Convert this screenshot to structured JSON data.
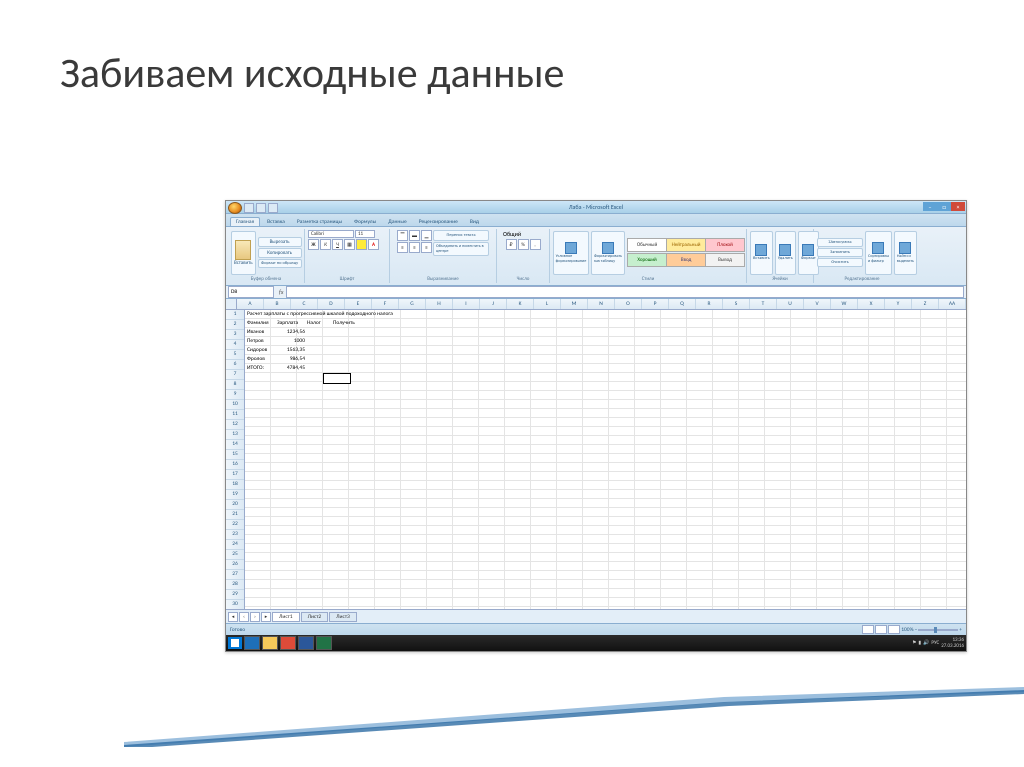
{
  "slide": {
    "title": "Забиваем исходные данные"
  },
  "window": {
    "title": "Лаба - Microsoft Excel",
    "min": "–",
    "max": "□",
    "close": "×"
  },
  "tabs": {
    "items": [
      "Главная",
      "Вставка",
      "Разметка страницы",
      "Формулы",
      "Данные",
      "Рецензирование",
      "Вид"
    ],
    "active": 0
  },
  "ribbon": {
    "clipboard": {
      "paste": "Вставить",
      "cut": "Вырезать",
      "copy": "Копировать",
      "format": "Формат по образцу",
      "label": "Буфер обмена"
    },
    "font": {
      "name": "Calibri",
      "size": "11",
      "label": "Шрифт"
    },
    "align": {
      "merge": "Объединить и поместить в центре",
      "wrap": "Перенос текста",
      "label": "Выравнивание"
    },
    "number": {
      "format": "Общий",
      "label": "Число"
    },
    "styles": {
      "cond": "Условное форматирование",
      "astable": "Форматировать как таблицу",
      "normal": "Обычный",
      "neutral": "Нейтральный",
      "bad": "Плохой",
      "good": "Хороший",
      "input": "Ввод",
      "output": "Вывод",
      "label": "Стили"
    },
    "cells": {
      "insert": "Вставить",
      "delete": "Удалить",
      "format": "Формат",
      "label": "Ячейки"
    },
    "editing": {
      "sum": "Автосумма",
      "fill": "Заполнить",
      "clear": "Очистить",
      "sort": "Сортировка и фильтр",
      "find": "Найти и выделить",
      "label": "Редактирование"
    }
  },
  "namebox": "D8",
  "columns": [
    "A",
    "B",
    "C",
    "D",
    "E",
    "F",
    "G",
    "H",
    "I",
    "J",
    "K",
    "L",
    "M",
    "N",
    "O",
    "P",
    "Q",
    "R",
    "S",
    "T",
    "U",
    "V",
    "W",
    "X",
    "Y",
    "Z",
    "AA"
  ],
  "sheet": {
    "title_row": "Расчет зарплаты с прогрессивной шкалой подоходного налога",
    "headers": [
      "Фамилия",
      "Зарплата",
      "Налог",
      "Получить"
    ],
    "rows": [
      {
        "name": "Иванов",
        "salary": "1234,56"
      },
      {
        "name": "Петров",
        "salary": "1000"
      },
      {
        "name": "Сидоров",
        "salary": "1563,35"
      },
      {
        "name": "Фролов",
        "salary": "986,54"
      },
      {
        "name": "ИТОГО:",
        "salary": "4784,45"
      }
    ]
  },
  "sheettabs": {
    "s1": "Лист1",
    "s2": "Лист2",
    "s3": "Лист3"
  },
  "status": {
    "ready": "Готово",
    "zoom": "100%"
  },
  "tray": {
    "lang": "РУС",
    "time": "13:36",
    "date": "27.03.2016"
  }
}
